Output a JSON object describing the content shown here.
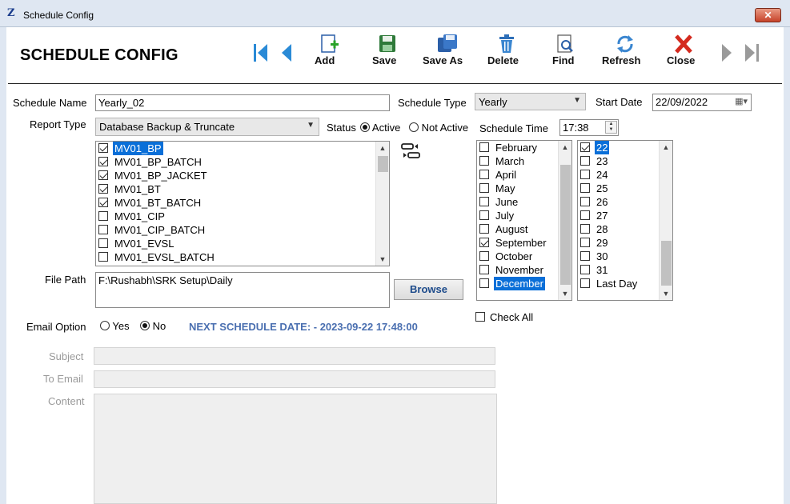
{
  "window": {
    "title": "Schedule Config",
    "close_glyph": "✕",
    "app_icon_glyph": "Z"
  },
  "header": {
    "title": "SCHEDULE CONFIG"
  },
  "nav": {
    "first_icon": "first-record-icon",
    "prev_icon": "previous-record-icon",
    "next_icon": "next-record-icon",
    "last_icon": "last-record-icon"
  },
  "toolbar": {
    "add": "Add",
    "save": "Save",
    "save_as": "Save As",
    "delete": "Delete",
    "find": "Find",
    "refresh": "Refresh",
    "close": "Close"
  },
  "form": {
    "schedule_name_label": "Schedule Name",
    "schedule_name_value": "Yearly_02",
    "schedule_type_label": "Schedule Type",
    "schedule_type_value": "Yearly",
    "start_date_label": "Start Date",
    "start_date_value": "22/09/2022",
    "report_type_label": "Report Type",
    "report_type_value": "Database Backup & Truncate",
    "status_label": "Status",
    "status_active": "Active",
    "status_not_active": "Not Active",
    "schedule_time_label": "Schedule Time",
    "schedule_time_value": "17:38",
    "file_path_label": "File Path",
    "file_path_value": "F:\\Rushabh\\SRK Setup\\Daily",
    "browse": "Browse",
    "email_option_label": "Email Option",
    "email_yes": "Yes",
    "email_no": "No",
    "next_schedule": "NEXT SCHEDULE DATE: - 2023-09-22 17:48:00",
    "check_all": "Check All",
    "subject_label": "Subject",
    "to_email_label": "To Email",
    "content_label": "Content"
  },
  "tables": [
    {
      "name": "MV01_BP",
      "checked": true,
      "selected": true
    },
    {
      "name": "MV01_BP_BATCH",
      "checked": true,
      "selected": false
    },
    {
      "name": "MV01_BP_JACKET",
      "checked": true,
      "selected": false
    },
    {
      "name": "MV01_BT",
      "checked": true,
      "selected": false
    },
    {
      "name": "MV01_BT_BATCH",
      "checked": true,
      "selected": false
    },
    {
      "name": "MV01_CIP",
      "checked": false,
      "selected": false
    },
    {
      "name": "MV01_CIP_BATCH",
      "checked": false,
      "selected": false
    },
    {
      "name": "MV01_EVSL",
      "checked": false,
      "selected": false
    },
    {
      "name": "MV01_EVSL_BATCH",
      "checked": false,
      "selected": false
    }
  ],
  "months": [
    {
      "name": "February",
      "checked": false,
      "selected": false
    },
    {
      "name": "March",
      "checked": false,
      "selected": false
    },
    {
      "name": "April",
      "checked": false,
      "selected": false
    },
    {
      "name": "May",
      "checked": false,
      "selected": false
    },
    {
      "name": "June",
      "checked": false,
      "selected": false
    },
    {
      "name": "July",
      "checked": false,
      "selected": false
    },
    {
      "name": "August",
      "checked": false,
      "selected": false
    },
    {
      "name": "September",
      "checked": true,
      "selected": false
    },
    {
      "name": "October",
      "checked": false,
      "selected": false
    },
    {
      "name": "November",
      "checked": false,
      "selected": false
    },
    {
      "name": "December",
      "checked": false,
      "selected": true
    }
  ],
  "days": [
    {
      "name": "22",
      "checked": true,
      "selected": true
    },
    {
      "name": "23",
      "checked": false,
      "selected": false
    },
    {
      "name": "24",
      "checked": false,
      "selected": false
    },
    {
      "name": "25",
      "checked": false,
      "selected": false
    },
    {
      "name": "26",
      "checked": false,
      "selected": false
    },
    {
      "name": "27",
      "checked": false,
      "selected": false
    },
    {
      "name": "28",
      "checked": false,
      "selected": false
    },
    {
      "name": "29",
      "checked": false,
      "selected": false
    },
    {
      "name": "30",
      "checked": false,
      "selected": false
    },
    {
      "name": "31",
      "checked": false,
      "selected": false
    },
    {
      "name": "Last Day",
      "checked": false,
      "selected": false
    }
  ],
  "colors": {
    "accent": "#0a6fd8",
    "next_schedule": "#4a6fb0",
    "close_red": "#d42a1e"
  }
}
